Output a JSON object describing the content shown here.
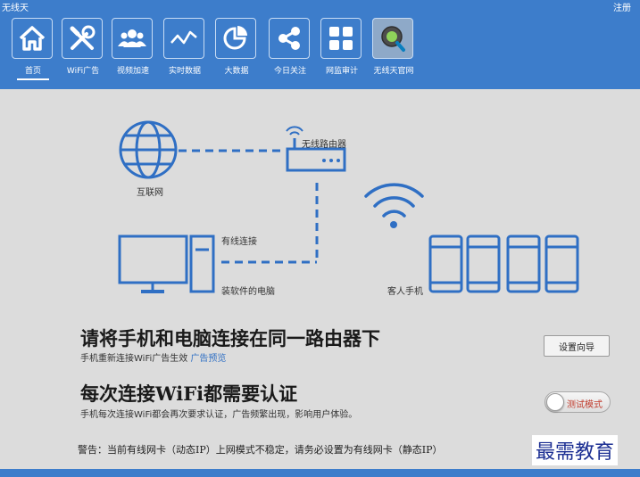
{
  "app": {
    "title": "无线天",
    "register_label": "注册"
  },
  "nav": [
    {
      "label": "首页",
      "icon": "home-icon",
      "active": true
    },
    {
      "label": "WiFi广告",
      "icon": "tools-icon"
    },
    {
      "label": "视频加速",
      "icon": "users-icon"
    },
    {
      "label": "实时数据",
      "icon": "line-chart-icon"
    },
    {
      "label": "大数据",
      "icon": "pie-chart-icon"
    },
    {
      "label": "今日关注",
      "icon": "share-icon"
    },
    {
      "label": "网监审计",
      "icon": "grid-icon"
    },
    {
      "label": "无线天官网",
      "icon": "globe-search-icon"
    }
  ],
  "diagram": {
    "internet_label": "互联网",
    "router_label": "无线路由器",
    "wired_label": "有线连接",
    "pc_label": "装软件的电脑",
    "phones_label": "客人手机"
  },
  "section1": {
    "heading": "请将手机和电脑连接在同一路由器下",
    "desc": "手机重新连接WiFi广告生效",
    "link": "广告预览",
    "button": "设置向导"
  },
  "section2": {
    "heading": "每次连接WiFi都需要认证",
    "desc": "手机每次连接WiFi都会再次要求认证，广告频繁出现，影响用户体验。",
    "toggle_label": "测试模式"
  },
  "warning": "警告：当前有线网卡（动态IP）上网模式不稳定，请务必设置为有线网卡（静态IP）",
  "watermark": "最需教育",
  "colors": {
    "header": "#3d7dcb",
    "diagram_blue": "#2f6fc4",
    "background": "#dcdcdc"
  }
}
